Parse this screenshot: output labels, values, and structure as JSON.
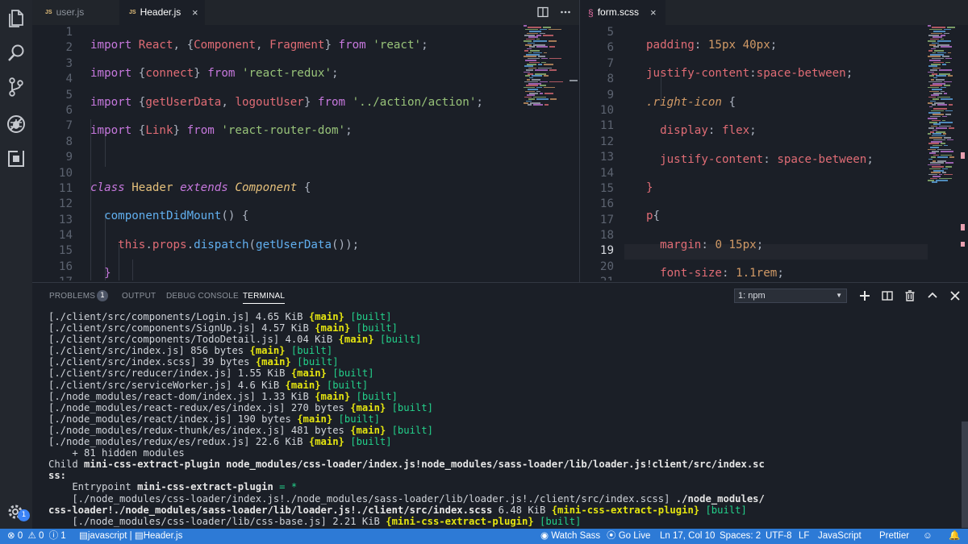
{
  "tabs_left": [
    {
      "type": "JS",
      "name": "user.js",
      "active": false
    },
    {
      "type": "JS",
      "name": "Header.js",
      "active": true,
      "close": "×"
    }
  ],
  "tabs_right": [
    {
      "type": "scss",
      "name": "form.scss",
      "active": true,
      "close": "×"
    }
  ],
  "activity_badge": "1",
  "editor_left": {
    "line_numbers": [
      "1",
      "2",
      "3",
      "4",
      "5",
      "6",
      "7",
      "8",
      "9",
      "10",
      "11",
      "12",
      "13",
      "14",
      "15",
      "16",
      "17"
    ]
  },
  "editor_right": {
    "line_numbers": [
      "5",
      "6",
      "7",
      "8",
      "9",
      "10",
      "11",
      "12",
      "13",
      "14",
      "15",
      "16",
      "17",
      "18",
      "19",
      "20",
      "21"
    ],
    "current_line": "19"
  },
  "panel": {
    "tabs": [
      "PROBLEMS",
      "OUTPUT",
      "DEBUG CONSOLE",
      "TERMINAL"
    ],
    "problems_count": "1",
    "terminal_select": "1: npm"
  },
  "terminal": {
    "modules": [
      {
        "path": "[./client/src/components/Login.js]",
        "size": "4.65 KiB"
      },
      {
        "path": "[./client/src/components/SignUp.js]",
        "size": "4.57 KiB"
      },
      {
        "path": "[./client/src/components/TodoDetail.js]",
        "size": "4.04 KiB"
      },
      {
        "path": "[./client/src/index.js]",
        "size": "856 bytes"
      },
      {
        "path": "[./client/src/index.scss]",
        "size": "39 bytes"
      },
      {
        "path": "[./client/src/reducer/index.js]",
        "size": "1.55 KiB"
      },
      {
        "path": "[./client/src/serviceWorker.js]",
        "size": "4.6 KiB"
      },
      {
        "path": "[./node_modules/react-dom/index.js]",
        "size": "1.33 KiB"
      },
      {
        "path": "[./node_modules/react-redux/es/index.js]",
        "size": "270 bytes"
      },
      {
        "path": "[./node_modules/react/index.js]",
        "size": "190 bytes"
      },
      {
        "path": "[./node_modules/redux-thunk/es/index.js]",
        "size": "481 bytes"
      },
      {
        "path": "[./node_modules/redux/es/redux.js]",
        "size": "22.6 KiB"
      }
    ],
    "chunk_main": "{main}",
    "built": "[built]",
    "hidden": "    + 81 hidden modules",
    "child_prefix": "Child ",
    "child_name": "mini-css-extract-plugin node_modules/css-loader/index.js!node_modules/sass-loader/lib/loader.js!client/src/index.sc",
    "child_wrap": "ss:",
    "entrypoint_prefix": "    Entrypoint ",
    "entrypoint_name": "mini-css-extract-plugin",
    "entrypoint_suffix": " = *",
    "dep_line_a": "    [./node_modules/css-loader/index.js!./node_modules/sass-loader/lib/loader.js!./client/src/index.scss] ",
    "dep_line_a_bold": "./node_modules/",
    "dep_line_b_bold": "css-loader!./node_modules/sass-loader/lib/loader.js!./client/src/index.scss",
    "dep_line_b_size": " 6.48 KiB ",
    "chunk_css": "{mini-css-extract-plugin}",
    "dep_line_c": "    [./node_modules/css-loader/lib/css-base.js] 2.21 KiB "
  },
  "status": {
    "errors": "0",
    "warnings": "0",
    "info": "1",
    "breadcrumb_lang": "javascript",
    "breadcrumb_sep": "|",
    "breadcrumb_file": "Header.js",
    "watch_sass": "Watch Sass",
    "go_live": "Go Live",
    "position": "Ln 17, Col 10",
    "spaces": "Spaces: 2",
    "encoding": "UTF-8",
    "eol": "LF",
    "language": "JavaScript",
    "formatter": "Prettier"
  },
  "colors": {
    "accent": "#2d7ad6",
    "background": "#1b1f27",
    "string": "#98c379",
    "keyword": "#c678dd",
    "function": "#61afef"
  }
}
